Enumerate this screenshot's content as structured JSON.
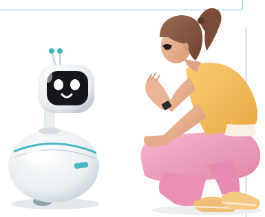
{
  "scene": {
    "subjects": [
      "robot",
      "woman"
    ],
    "colors": {
      "frame": "#7fc7d4",
      "robot_body": "#f1f4f6",
      "robot_screen": "#15161c",
      "robot_eyes": "#ffffff",
      "robot_trim": "#37aebd",
      "shirt": "#f6be5a",
      "pants": "#ef9dbd",
      "hair": "#8a5a44",
      "skin": "#e8b08f",
      "shoes": "#f1c07a"
    }
  }
}
